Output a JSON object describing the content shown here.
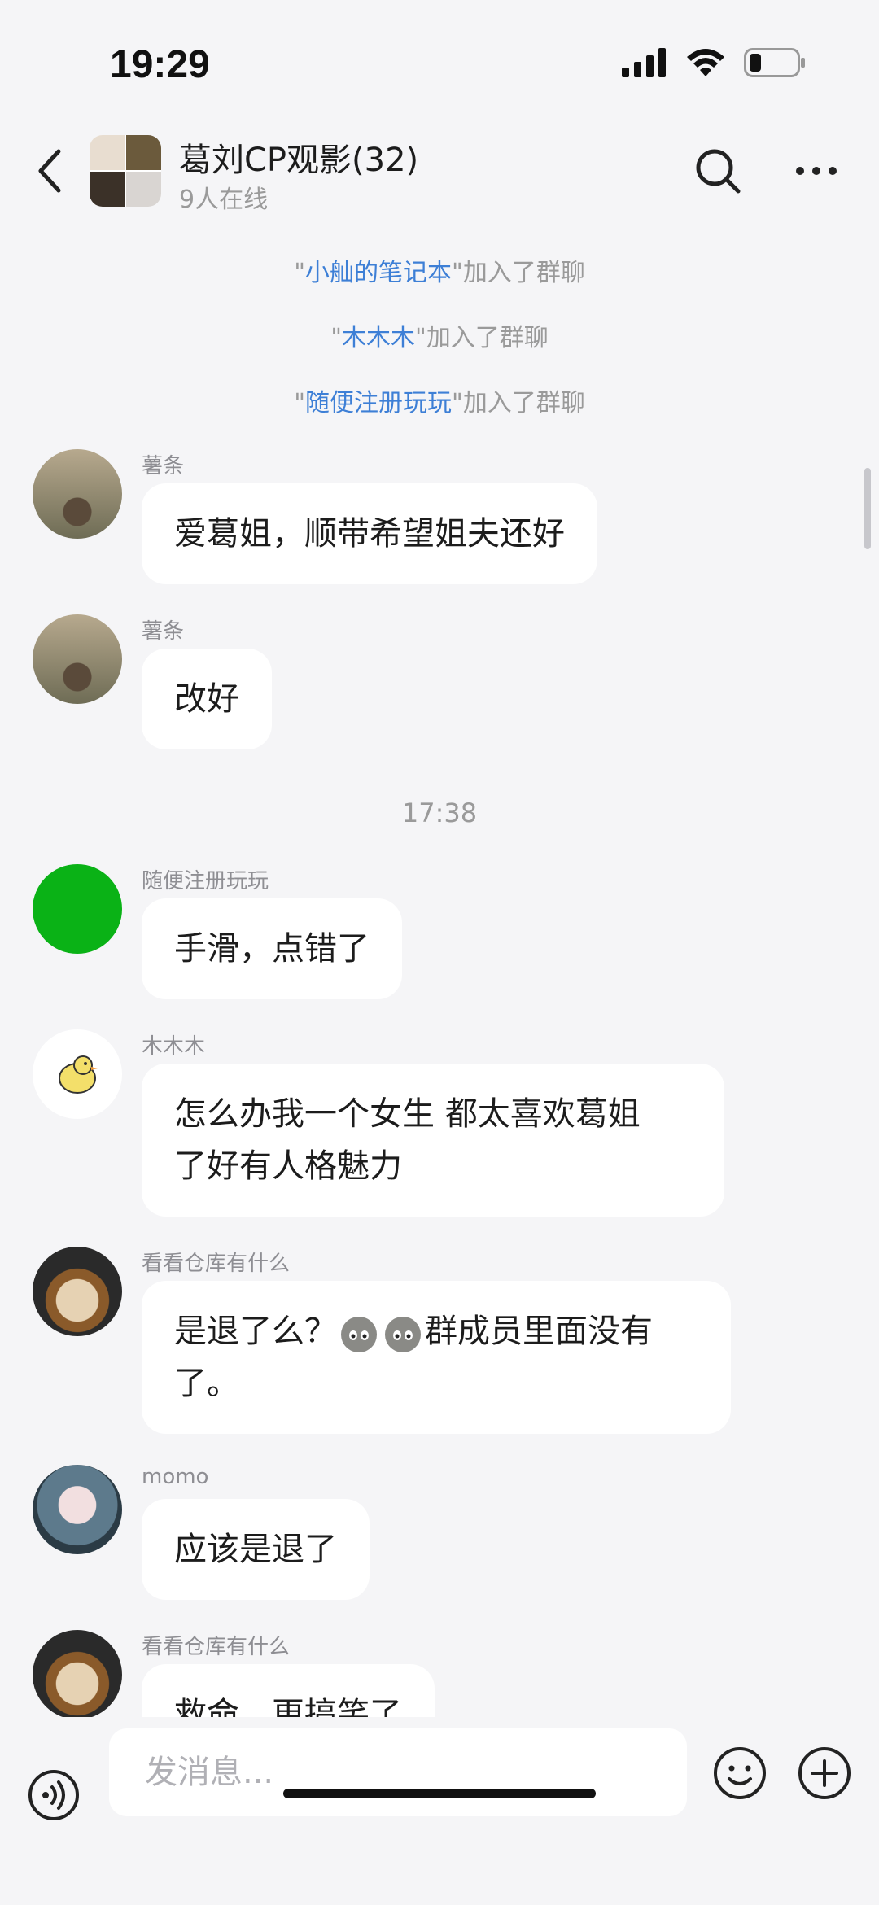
{
  "status": {
    "time": "19:29"
  },
  "header": {
    "title": "葛刘CP观影(32)",
    "subtitle": "9人在线"
  },
  "system_messages": [
    {
      "name": "小舢的笔记本",
      "text": "加入了群聊"
    },
    {
      "name": "木木木",
      "text": "加入了群聊"
    },
    {
      "name": "随便注册玩玩",
      "text": "加入了群聊"
    }
  ],
  "messages": [
    {
      "sender": "薯条",
      "text": "爱葛姐，顺带希望姐夫还好"
    },
    {
      "sender": "薯条",
      "text": "改好"
    },
    {
      "sender": "随便注册玩玩",
      "text": "手滑，点错了",
      "avatar_color": "#0ab216"
    },
    {
      "sender": "木木木",
      "line1": "怎么办我一个女生 都太喜欢葛姐",
      "line2": "了好有人格魅力"
    },
    {
      "sender": "看看仓库有什么",
      "line1a": "是退了么？",
      "line1b": "群成员里面没有",
      "line2": "了。"
    },
    {
      "sender": "momo",
      "text": "应该是退了"
    },
    {
      "sender": "看看仓库有什么",
      "text": "救命，更搞笑了"
    }
  ],
  "time_separator": "17:38",
  "input": {
    "placeholder": "发消息..."
  },
  "colors": {
    "background": "#f5f5f7",
    "link": "#3d7fd6",
    "bubble": "#ffffff"
  },
  "icons": [
    "back-icon",
    "search-icon",
    "more-icon",
    "voice-icon",
    "emoji-icon",
    "plus-icon"
  ]
}
